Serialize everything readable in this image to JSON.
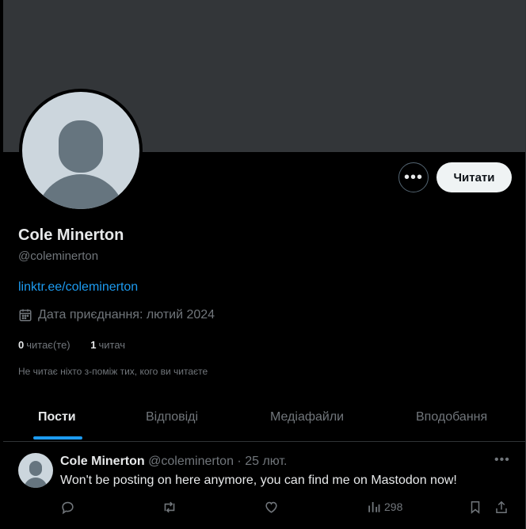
{
  "profile": {
    "name": "Cole Minerton",
    "handle": "@coleminerton",
    "link": "linktr.ee/coleminerton",
    "joined": "Дата приєднання: лютий 2024",
    "following_count": "0",
    "following_label": "читає(те)",
    "followers_count": "1",
    "followers_label": "читач",
    "not_followed_note": "Не читає ніхто з-поміж тих, кого ви читаєте",
    "follow_button": "Читати"
  },
  "tabs": [
    {
      "label": "Пости",
      "active": true
    },
    {
      "label": "Відповіді",
      "active": false
    },
    {
      "label": "Медіафайли",
      "active": false
    },
    {
      "label": "Вподобання",
      "active": false
    }
  ],
  "post": {
    "author": "Cole Minerton",
    "handle": "@coleminerton",
    "separator": "·",
    "date": "25 лют.",
    "text": "Won't be posting on here anymore, you can find me on Mastodon now!",
    "views": "298"
  },
  "colors": {
    "accent": "#1d9bf0",
    "background": "#000000",
    "banner": "#333639",
    "muted_text": "#71767b"
  },
  "icons": [
    "more-icon",
    "calendar-icon",
    "reply-icon",
    "retweet-icon",
    "like-icon",
    "views-icon",
    "bookmark-icon",
    "share-icon"
  ]
}
